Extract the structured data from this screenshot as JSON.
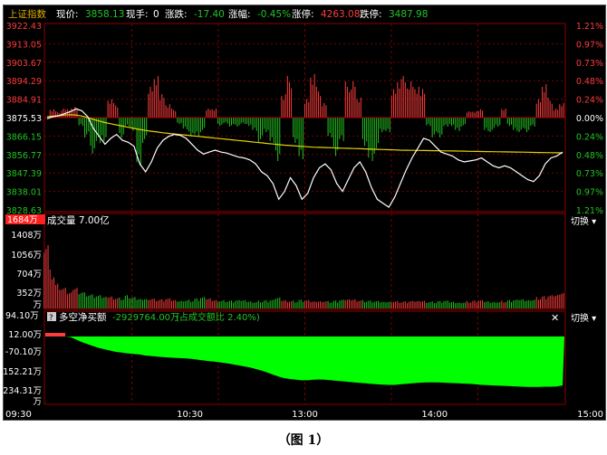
{
  "header": {
    "index_name": "上证指数",
    "price_label": "现价:",
    "price": "3858.13",
    "lot_label": "现手:",
    "lot": "0",
    "change_label": "涨跌:",
    "change": "-17.40",
    "pct_label": "涨幅:",
    "pct": "-0.45%",
    "limit_up_label": "涨停:",
    "limit_up": "4263.08",
    "limit_down_label": "跌停:",
    "limit_down": "3487.98"
  },
  "price_axis": {
    "left": [
      "3922.43",
      "3913.05",
      "3903.67",
      "3894.29",
      "3884.91",
      "3875.53",
      "3866.15",
      "3856.77",
      "3847.39",
      "3838.01",
      "3828.63"
    ],
    "right": [
      "1.21%",
      "0.97%",
      "0.73%",
      "0.48%",
      "0.24%",
      "0.00%",
      "0.24%",
      "0.48%",
      "0.73%",
      "0.97%",
      "1.21%"
    ]
  },
  "volume_panel": {
    "highlight": "1684万",
    "title": "成交量 7.00亿",
    "switch_label": "切换 ▾",
    "axis": [
      "1408万",
      "1056万",
      "704万",
      "352万",
      "万"
    ]
  },
  "netbuy_panel": {
    "top_value": "94.10万",
    "icon_label": "?",
    "title": "多空净买额",
    "value": "-2929764.00万",
    "ratio": "(占成交额比 2.40%)",
    "close_label": "✕",
    "switch_label": "切换 ▾",
    "axis": [
      "12.00万",
      "-70.10万",
      "152.21万",
      "234.31万",
      "万"
    ]
  },
  "time_axis": [
    "09:30",
    "10:30",
    "13:00",
    "14:00",
    "15:00"
  ],
  "caption": "（图 1）",
  "colors": {
    "up": "#ff3c3c",
    "down": "#22c422",
    "flat": "#ffffff",
    "price_line": "#ffffff",
    "avg_line": "#e6d200",
    "grid": "#7a0000",
    "net_fill": "#00ff00",
    "label_gold": "#e0b000"
  },
  "chart_data": [
    {
      "type": "line",
      "x_range": [
        "09:30",
        "15:00"
      ],
      "ylim": [
        3828.63,
        3922.43
      ],
      "prev_close": 3875.53,
      "series": [
        {
          "values": [
            3875.0,
            3876.0,
            3876.5,
            3877.5,
            3878.5,
            3880.0,
            3879.0,
            3876.0,
            3870.0,
            3866.0,
            3862.0,
            3865.0,
            3867.0,
            3864.0,
            3863.0,
            3861.0,
            3852.0,
            3848.0,
            3853.0,
            3860.0,
            3864.0,
            3866.0,
            3867.0,
            3866.5,
            3865.0,
            3862.0,
            3859.0,
            3857.0,
            3858.0,
            3859.0,
            3858.0,
            3857.5,
            3856.5,
            3855.5,
            3855.0,
            3854.0,
            3852.0,
            3848.0,
            3846.0,
            3842.0,
            3834.0,
            3838.0,
            3845.0,
            3841.0,
            3834.0,
            3837.0,
            3845.0,
            3850.0,
            3852.0,
            3849.0,
            3842.0,
            3838.0,
            3844.0,
            3850.0,
            3853.0,
            3848.0,
            3840.0,
            3834.0,
            3832.0,
            3830.0,
            3835.0,
            3842.0,
            3849.0,
            3855.0,
            3860.0,
            3865.0,
            3864.0,
            3861.0,
            3858.0,
            3857.0,
            3856.0,
            3854.0,
            3853.0,
            3853.5,
            3854.0,
            3855.0,
            3853.0,
            3851.0,
            3850.0,
            3851.0,
            3850.0,
            3848.0,
            3846.0,
            3844.0,
            3843.0,
            3846.0,
            3852.0,
            3855.0,
            3856.0,
            3858.0
          ]
        },
        {
          "values": [
            3876.0,
            3876.2,
            3876.5,
            3876.8,
            3877.0,
            3876.8,
            3876.3,
            3875.5,
            3874.6,
            3873.8,
            3873.0,
            3872.4,
            3871.8,
            3871.2,
            3870.6,
            3870.0,
            3869.5,
            3869.0,
            3868.6,
            3868.2,
            3867.8,
            3867.5,
            3867.2,
            3866.9,
            3866.6,
            3866.3,
            3866.0,
            3865.7,
            3865.4,
            3865.1,
            3864.8,
            3864.5,
            3864.2,
            3863.9,
            3863.6,
            3863.3,
            3863.0,
            3862.7,
            3862.4,
            3862.1,
            3861.8,
            3861.5,
            3861.3,
            3861.1,
            3860.9,
            3860.7,
            3860.5,
            3860.4,
            3860.3,
            3860.2,
            3860.1,
            3860.0,
            3859.9,
            3859.8,
            3859.7,
            3859.6,
            3859.5,
            3859.4,
            3859.3,
            3859.2,
            3859.1,
            3859.0,
            3858.95,
            3858.9,
            3858.85,
            3858.8,
            3858.75,
            3858.7,
            3858.65,
            3858.6,
            3858.55,
            3858.5,
            3858.45,
            3858.4,
            3858.35,
            3858.3,
            3858.25,
            3858.2,
            3858.15,
            3858.1,
            3858.05,
            3858.0,
            3857.95,
            3857.9,
            3857.85,
            3857.8,
            3857.75,
            3857.7,
            3857.65,
            3857.6
          ]
        }
      ]
    },
    {
      "type": "bar",
      "ylim": [
        0,
        1700
      ],
      "series": [
        {
          "values": [
            1684,
            880,
            560,
            470,
            380,
            520,
            430,
            360,
            320,
            300,
            280,
            300,
            270,
            250,
            300,
            260,
            230,
            240,
            250,
            220,
            210,
            230,
            200,
            190,
            210,
            200,
            230,
            260,
            240,
            210,
            200,
            190,
            180,
            190,
            200,
            180,
            170,
            180,
            190,
            200,
            260,
            210,
            190,
            180,
            200,
            190,
            170,
            180,
            190,
            170,
            180,
            200,
            220,
            230,
            210,
            190,
            180,
            170,
            160,
            170,
            180,
            170,
            160,
            170,
            180,
            190,
            170,
            160,
            170,
            180,
            160,
            150,
            160,
            170,
            180,
            190,
            170,
            160,
            170,
            180,
            190,
            200,
            220,
            210,
            230,
            260,
            280,
            300,
            320,
            390
          ]
        }
      ]
    },
    {
      "type": "area",
      "ylim": [
        -260,
        94.1
      ],
      "series": [
        {
          "values": [
            12,
            10,
            8,
            5,
            -2,
            -12,
            -22,
            -30,
            -38,
            -45,
            -50,
            -55,
            -60,
            -63,
            -66,
            -68,
            -70,
            -74,
            -76,
            -78,
            -80,
            -82,
            -83,
            -84,
            -85,
            -87,
            -90,
            -93,
            -96,
            -98,
            -101,
            -104,
            -108,
            -112,
            -116,
            -120,
            -126,
            -132,
            -140,
            -148,
            -156,
            -162,
            -165,
            -168,
            -170,
            -170,
            -168,
            -167,
            -168,
            -170,
            -172,
            -174,
            -176,
            -178,
            -180,
            -182,
            -184,
            -186,
            -187,
            -188,
            -188,
            -186,
            -184,
            -182,
            -180,
            -179,
            -178,
            -178,
            -179,
            -180,
            -181,
            -182,
            -183,
            -184,
            -186,
            -188,
            -189,
            -190,
            -191,
            -192,
            -193,
            -194,
            -195,
            -196,
            -196,
            -196,
            -195,
            -195,
            -194,
            -190
          ]
        }
      ]
    }
  ]
}
